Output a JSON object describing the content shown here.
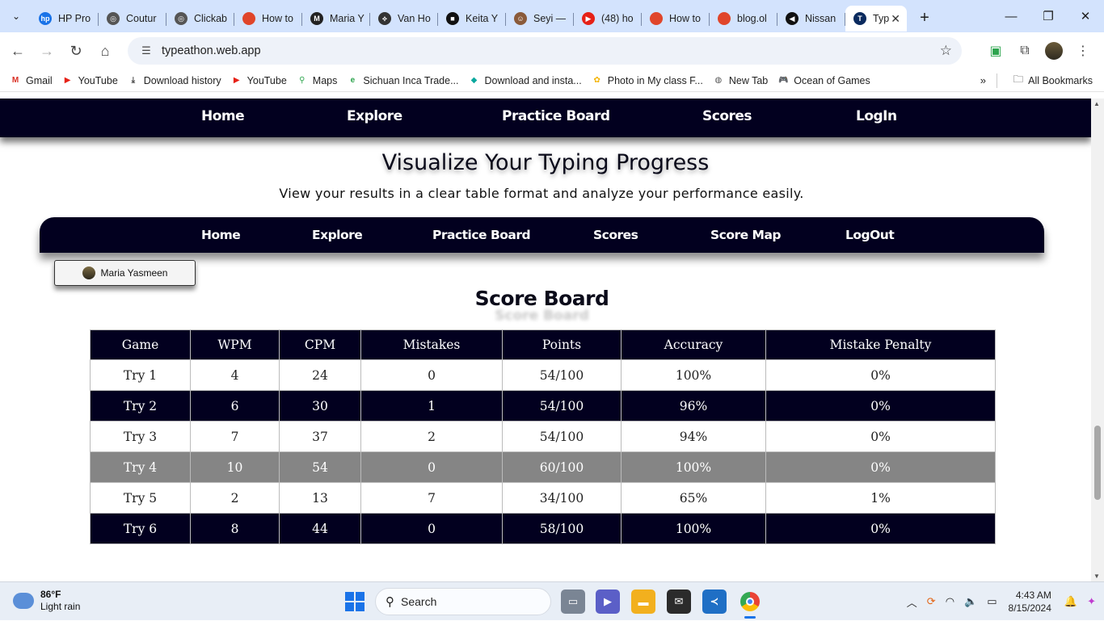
{
  "browser": {
    "tabs": [
      {
        "title": "HP Pro",
        "color": "#1a73e8",
        "glyph": "hp"
      },
      {
        "title": "Coutur",
        "color": "#555555",
        "glyph": "◎"
      },
      {
        "title": "Clickab",
        "color": "#555555",
        "glyph": "◎"
      },
      {
        "title": "How to",
        "color": "#e0452a",
        "glyph": ""
      },
      {
        "title": "Maria Y",
        "color": "#222222",
        "glyph": "M"
      },
      {
        "title": "Van Ho",
        "color": "#333333",
        "glyph": "⟡"
      },
      {
        "title": "Keita Y",
        "color": "#111111",
        "glyph": "■"
      },
      {
        "title": "Seyi —",
        "color": "#8a5a3a",
        "glyph": "☺"
      },
      {
        "title": "(48) ho",
        "color": "#e62117",
        "glyph": "▶"
      },
      {
        "title": "How to",
        "color": "#e0452a",
        "glyph": ""
      },
      {
        "title": "blog.ol",
        "color": "#e0452a",
        "glyph": ""
      },
      {
        "title": "Nissan",
        "color": "#111111",
        "glyph": "◀"
      },
      {
        "title": "Typ",
        "color": "#0a2a5e",
        "glyph": "T",
        "active": true
      }
    ],
    "url": "typeathon.web.app",
    "bookmarks": [
      {
        "label": "Gmail",
        "color": "#d93025",
        "glyph": "M"
      },
      {
        "label": "YouTube",
        "color": "#e62117",
        "glyph": "▶"
      },
      {
        "label": "Download history",
        "color": "#444444",
        "glyph": "⤓"
      },
      {
        "label": "YouTube",
        "color": "#e62117",
        "glyph": "▶"
      },
      {
        "label": "Maps",
        "color": "#34a853",
        "glyph": "⚲"
      },
      {
        "label": "Sichuan Inca Trade...",
        "color": "#2da44e",
        "glyph": "e"
      },
      {
        "label": "Download and insta...",
        "color": "#0aa89e",
        "glyph": "◆"
      },
      {
        "label": "Photo in My class F...",
        "color": "#f4b400",
        "glyph": "✿"
      },
      {
        "label": "New Tab",
        "color": "#555555",
        "glyph": "◍"
      },
      {
        "label": "Ocean of Games",
        "color": "#c62828",
        "glyph": "🎮"
      }
    ],
    "bookmarks_more": "»",
    "all_bookmarks": "All Bookmarks"
  },
  "site": {
    "top_nav": [
      "Home",
      "Explore",
      "Practice Board",
      "Scores",
      "LogIn"
    ],
    "hero_title": "Visualize Your Typing Progress",
    "hero_subtitle": "View your results in a clear table format and analyze your performance easily.",
    "inner_nav": [
      "Home",
      "Explore",
      "Practice Board",
      "Scores",
      "Score Map",
      "LogOut"
    ],
    "user_name": "Maria Yasmeen",
    "scoreboard_title": "Score Board",
    "scoreboard_shadow": "Score Board"
  },
  "table": {
    "headers": [
      "Game",
      "WPM",
      "CPM",
      "Mistakes",
      "Points",
      "Accuracy",
      "Mistake Penalty"
    ],
    "rows": [
      {
        "style": "light",
        "cells": [
          "Try 1",
          "4",
          "24",
          "0",
          "54/100",
          "100%",
          "0%"
        ]
      },
      {
        "style": "dark",
        "cells": [
          "Try 2",
          "6",
          "30",
          "1",
          "54/100",
          "96%",
          "0%"
        ]
      },
      {
        "style": "light",
        "cells": [
          "Try 3",
          "7",
          "37",
          "2",
          "54/100",
          "94%",
          "0%"
        ]
      },
      {
        "style": "grey",
        "cells": [
          "Try 4",
          "10",
          "54",
          "0",
          "60/100",
          "100%",
          "0%"
        ]
      },
      {
        "style": "light",
        "cells": [
          "Try 5",
          "2",
          "13",
          "7",
          "34/100",
          "65%",
          "1%"
        ]
      },
      {
        "style": "dark",
        "cells": [
          "Try 6",
          "8",
          "44",
          "0",
          "58/100",
          "100%",
          "0%"
        ]
      }
    ]
  },
  "taskbar": {
    "temp": "86°F",
    "weather": "Light rain",
    "search": "Search",
    "time": "4:43 AM",
    "date": "8/15/2024"
  },
  "colors": {
    "nav_bg": "#02001f",
    "tab_strip": "#d3e3fd",
    "row_grey": "#858585"
  }
}
